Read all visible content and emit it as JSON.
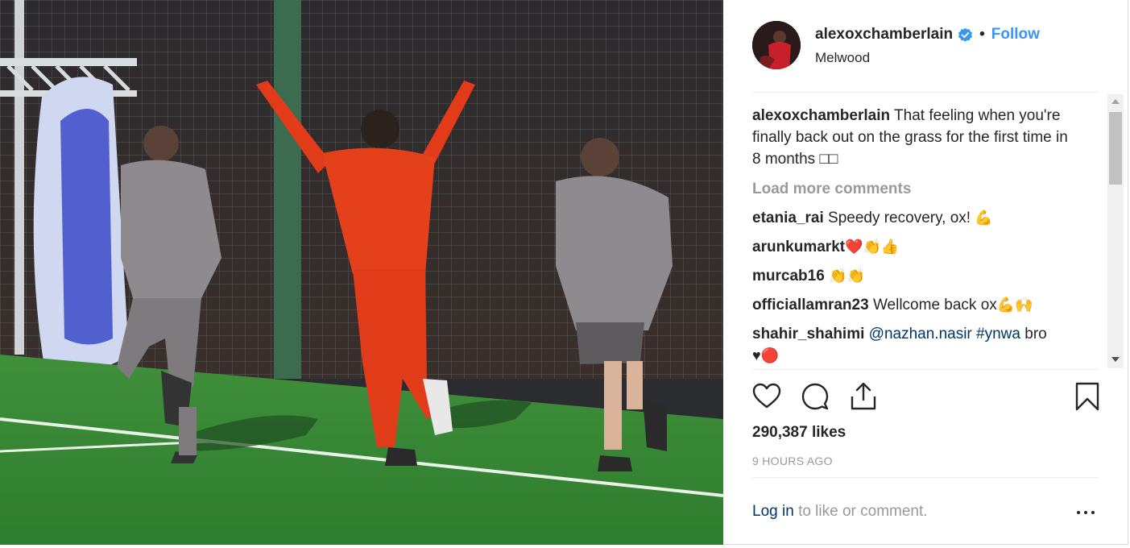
{
  "post": {
    "username": "alexoxchamberlain",
    "separator": "•",
    "follow_label": "Follow",
    "location": "Melwood",
    "caption": {
      "username": "alexoxchamberlain",
      "text": "That feeling when you're finally back out on the grass for the first time in 8 months",
      "trailing": "□□"
    },
    "load_more_label": "Load more comments",
    "comments": [
      {
        "username": "etania_rai",
        "text": "Speedy recovery, ox!",
        "emoji": "💪"
      },
      {
        "username": "arunkumarkt",
        "text": "",
        "emoji": "❤️👏👍"
      },
      {
        "username": "murcab16",
        "text": "",
        "emoji": "👏👏"
      },
      {
        "username": "officiallamran23",
        "text": "Wellcome back ox",
        "emoji": "💪🙌"
      },
      {
        "username": "shahir_shahimi",
        "mention": "@nazhan.nasir",
        "hashtag": "#ynwa",
        "text": "bro",
        "emoji": "♥🔴"
      }
    ],
    "likes_text": "290,387 likes",
    "time_text": "9 HOURS AGO",
    "login_link": "Log in",
    "login_rest": "to like or comment."
  },
  "icons": {
    "verified": "verified-badge-icon",
    "like": "heart-icon",
    "comment": "comment-bubble-icon",
    "share": "share-icon",
    "save": "bookmark-icon",
    "more": "more-options-icon"
  },
  "colors": {
    "link_blue": "#3897f0",
    "mention_blue": "#003569",
    "muted": "#999999",
    "text": "#262626"
  }
}
